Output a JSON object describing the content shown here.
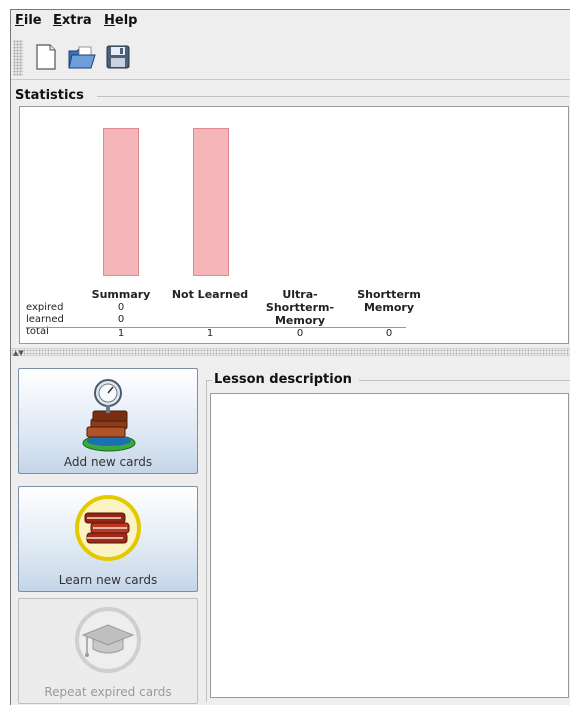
{
  "menu": {
    "file": {
      "mnemonic": "F",
      "rest": "ile"
    },
    "extra": {
      "mnemonic": "E",
      "rest": "xtra"
    },
    "help": {
      "mnemonic": "H",
      "rest": "elp"
    }
  },
  "toolbar": {
    "buttons": [
      {
        "icon": "new-document-icon"
      },
      {
        "icon": "open-folder-icon"
      },
      {
        "icon": "save-disk-icon"
      }
    ]
  },
  "statistics": {
    "title": "Statistics",
    "columns": [
      {
        "head1": "Summary",
        "head2": "",
        "head3": "",
        "expired": "0",
        "learned": "0",
        "total": "1",
        "bar_value": 1
      },
      {
        "head1": "Not Learned",
        "head2": "",
        "head3": "",
        "expired": "",
        "learned": "",
        "total": "1",
        "bar_value": 1
      },
      {
        "head1": "Ultra-",
        "head2": "Shortterm-",
        "head3": "Memory",
        "expired": "",
        "learned": "",
        "total": "0",
        "bar_value": 0
      },
      {
        "head1": "Shortterm",
        "head2": "Memory",
        "head3": "",
        "expired": "",
        "learned": "",
        "total": "0",
        "bar_value": 0
      }
    ],
    "row_labels": {
      "expired": "expired",
      "learned": "learned",
      "total": "total"
    },
    "bar_color": "#f4b6b8"
  },
  "actions": {
    "add": {
      "label": "Add new cards",
      "icon": "add-cards-icon"
    },
    "learn": {
      "label": "Learn new cards",
      "icon": "learn-books-icon"
    },
    "repeat": {
      "label": "Repeat expired cards",
      "icon": "graduation-cap-icon"
    }
  },
  "lesson": {
    "title": "Lesson description",
    "text": ""
  }
}
